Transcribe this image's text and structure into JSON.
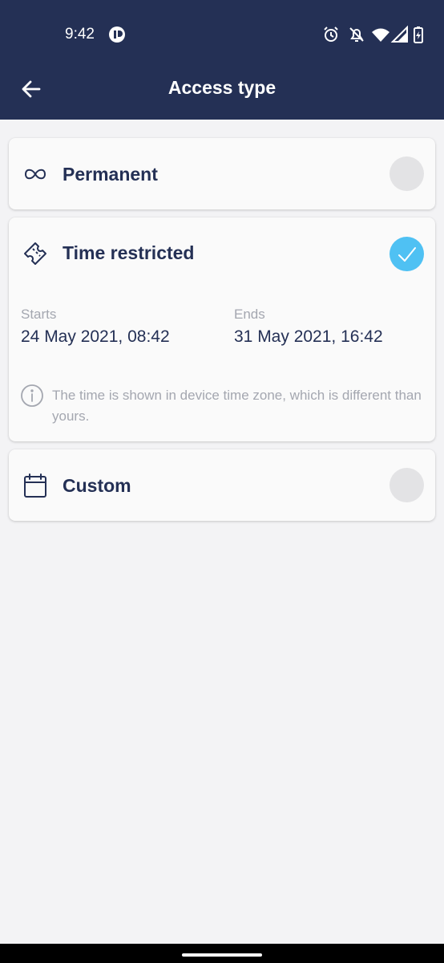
{
  "status_bar": {
    "time": "9:42",
    "icons": [
      "app-notification-icon",
      "alarm-icon",
      "notifications-off-icon",
      "wifi-icon",
      "signal-icon",
      "battery-charging-icon"
    ]
  },
  "app_bar": {
    "title": "Access type",
    "back_icon": "arrow-left-icon"
  },
  "options": {
    "permanent": {
      "label": "Permanent",
      "icon": "infinity-icon",
      "selected": false
    },
    "time_restricted": {
      "label": "Time restricted",
      "icon": "ticket-icon",
      "selected": true,
      "starts_label": "Starts",
      "starts_value": "24 May 2021, 08:42",
      "ends_label": "Ends",
      "ends_value": "31 May 2021, 16:42",
      "info_icon": "info-icon",
      "info_text": "The time is shown in device time zone, which is different than yours."
    },
    "custom": {
      "label": "Custom",
      "icon": "calendar-icon",
      "selected": false
    }
  },
  "colors": {
    "header": "#243055",
    "accent": "#4fc1f3",
    "text_primary": "#243055",
    "text_muted": "#a4a7b0",
    "background": "#f3f3f5"
  }
}
